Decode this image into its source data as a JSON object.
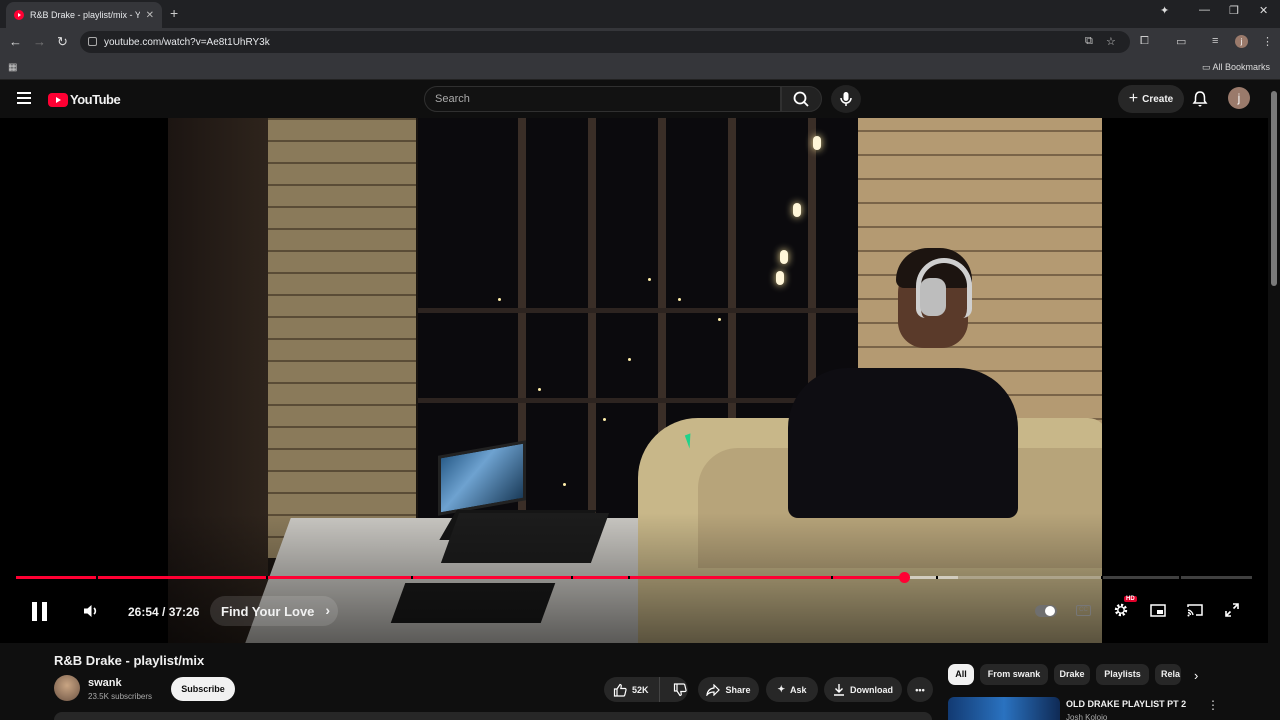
{
  "browser": {
    "tab_title": "R&B Drake - playlist/mix - Y",
    "url": "youtube.com/watch?v=Ae8t1UhRY3k",
    "bookmarks_label": "All Bookmarks",
    "profile_initial": "j"
  },
  "header": {
    "logo_text": "YouTube",
    "search_placeholder": "Search",
    "create_label": "Create",
    "avatar_initial": "j"
  },
  "player": {
    "current_time": "26:54",
    "duration": "37:26",
    "time_display": "26:54 / 37:26",
    "progress_fraction": 0.7186,
    "buffered_fraction": 0.7625,
    "chapter_title": "Find Your Love",
    "quality_badge": "HD",
    "playing": true
  },
  "video": {
    "title": "R&B Drake - playlist/mix",
    "channel_name": "swank",
    "subscribers": "23.5K subscribers",
    "subscribe_label": "Subscribe",
    "likes": "52K",
    "share_label": "Share",
    "ask_label": "Ask",
    "download_label": "Download"
  },
  "sidebar": {
    "chips": [
      "All",
      "From swank",
      "Drake",
      "Playlists",
      "Rela"
    ],
    "recommendation": {
      "title": "OLD DRAKE PLAYLIST PT 2",
      "channel": "Josh Kolojo"
    }
  },
  "colors": {
    "accent": "#ff0033",
    "background": "#0f0f0f",
    "pill": "#272727"
  }
}
